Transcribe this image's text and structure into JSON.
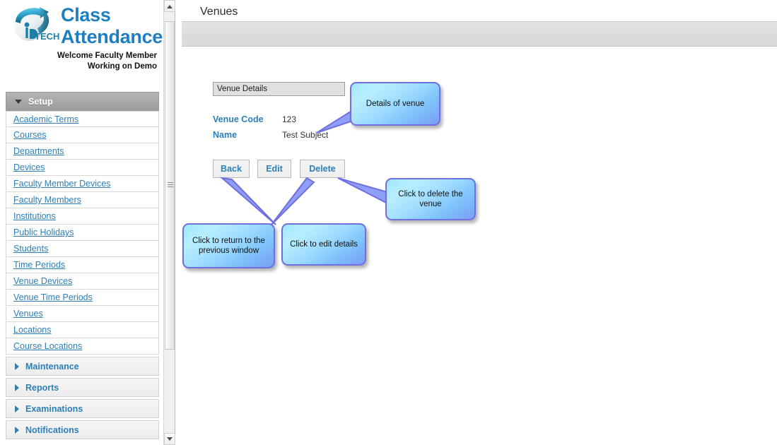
{
  "brand": {
    "line1": "Class",
    "line2": "Attendance",
    "logo_icon": "iptech-logo-icon",
    "logo_mark_text": "TECH",
    "welcome_line1": "Welcome Faculty Member",
    "welcome_line2": "Working on Demo"
  },
  "sidebar": {
    "sections": [
      {
        "label": "Setup",
        "state": "open",
        "icon": "chevron-down-icon",
        "items": [
          {
            "label": "Academic Terms"
          },
          {
            "label": "Courses"
          },
          {
            "label": "Departments"
          },
          {
            "label": "Devices"
          },
          {
            "label": "Faculty Member Devices"
          },
          {
            "label": "Faculty Members"
          },
          {
            "label": "Institutions"
          },
          {
            "label": "Public Holidays"
          },
          {
            "label": "Students"
          },
          {
            "label": "Time Periods"
          },
          {
            "label": "Venue Devices"
          },
          {
            "label": "Venue Time Periods"
          },
          {
            "label": "Venues"
          },
          {
            "label": "Locations"
          },
          {
            "label": "Course Locations"
          }
        ]
      },
      {
        "label": "Maintenance",
        "state": "closed",
        "icon": "chevron-right-icon",
        "items": []
      },
      {
        "label": "Reports",
        "state": "closed",
        "icon": "chevron-right-icon",
        "items": []
      },
      {
        "label": "Examinations",
        "state": "closed",
        "icon": "chevron-right-icon",
        "items": []
      },
      {
        "label": "Notifications",
        "state": "closed",
        "icon": "chevron-right-icon",
        "items": []
      }
    ],
    "scrollbar": {
      "up_icon": "scroll-up-arrow-icon",
      "down_icon": "scroll-down-arrow-icon",
      "grip_icon": "scrollbar-grip-icon"
    }
  },
  "main": {
    "page_title": "Venues",
    "panel_title": "Venue Details",
    "fields": [
      {
        "label": "Venue Code",
        "value": "123"
      },
      {
        "label": "Name",
        "value": "Test Subject"
      }
    ],
    "buttons": [
      {
        "label": "Back"
      },
      {
        "label": "Edit"
      },
      {
        "label": "Delete"
      }
    ]
  },
  "callouts": [
    {
      "id": "details",
      "text": "Details of venue"
    },
    {
      "id": "back",
      "text": "Click to return to the previous window"
    },
    {
      "id": "edit",
      "text": "Click to edit details"
    },
    {
      "id": "delete",
      "text": "Click to delete the venue"
    }
  ],
  "colors": {
    "link_blue": "#2c7fb8",
    "callout_border": "#6f6fe0",
    "callout_fill_top": "#b8eeff",
    "callout_fill_bottom": "#7a9cf5",
    "header_gray": "#dedede",
    "section_open_gray": "#a8a8a8"
  }
}
